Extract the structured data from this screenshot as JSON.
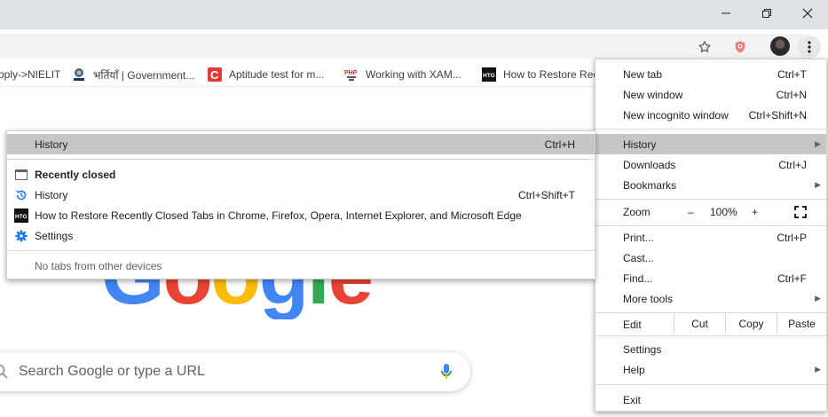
{
  "window": {
    "controls": [
      "minimize",
      "restore",
      "close"
    ]
  },
  "toolbar": {
    "icons": [
      "star-icon",
      "shield-extension-icon",
      "profile-avatar",
      "kebab-menu-icon"
    ]
  },
  "bookmarks": [
    {
      "label": "pply->NIELIT",
      "icon": "none"
    },
    {
      "label": "भर्तियाँ | Government...",
      "icon": "nielit-favicon"
    },
    {
      "label": "Aptitude test for m...",
      "icon": "c-favicon"
    },
    {
      "label": "Working with XAM...",
      "icon": "php-favicon"
    },
    {
      "label": "How to Restore Rec",
      "icon": "htg-favicon"
    }
  ],
  "google_logo": "Google",
  "search": {
    "placeholder": "Search Google or type a URL"
  },
  "menu": {
    "new_tab": {
      "label": "New tab",
      "shortcut": "Ctrl+T"
    },
    "new_window": {
      "label": "New window",
      "shortcut": "Ctrl+N"
    },
    "new_incognito": {
      "label": "New incognito window",
      "shortcut": "Ctrl+Shift+N"
    },
    "history": {
      "label": "History"
    },
    "downloads": {
      "label": "Downloads",
      "shortcut": "Ctrl+J"
    },
    "bookmarks": {
      "label": "Bookmarks"
    },
    "zoom": {
      "label": "Zoom",
      "minus": "–",
      "value": "100%",
      "plus": "+"
    },
    "print": {
      "label": "Print...",
      "shortcut": "Ctrl+P"
    },
    "cast": {
      "label": "Cast..."
    },
    "find": {
      "label": "Find...",
      "shortcut": "Ctrl+F"
    },
    "more_tools": {
      "label": "More tools"
    },
    "edit": {
      "label": "Edit",
      "cut": "Cut",
      "copy": "Copy",
      "paste": "Paste"
    },
    "settings": {
      "label": "Settings"
    },
    "help": {
      "label": "Help"
    },
    "exit": {
      "label": "Exit"
    }
  },
  "history_submenu": {
    "history": {
      "label": "History",
      "shortcut": "Ctrl+H"
    },
    "recently_closed": {
      "label": "Recently closed"
    },
    "history_item": {
      "label": "History",
      "shortcut": "Ctrl+Shift+T"
    },
    "closed_tab": {
      "label": "How to Restore Recently Closed Tabs in Chrome, Firefox, Opera, Internet Explorer, and Microsoft Edge"
    },
    "settings_item": {
      "label": "Settings"
    },
    "no_tabs": {
      "label": "No tabs from other devices"
    }
  }
}
